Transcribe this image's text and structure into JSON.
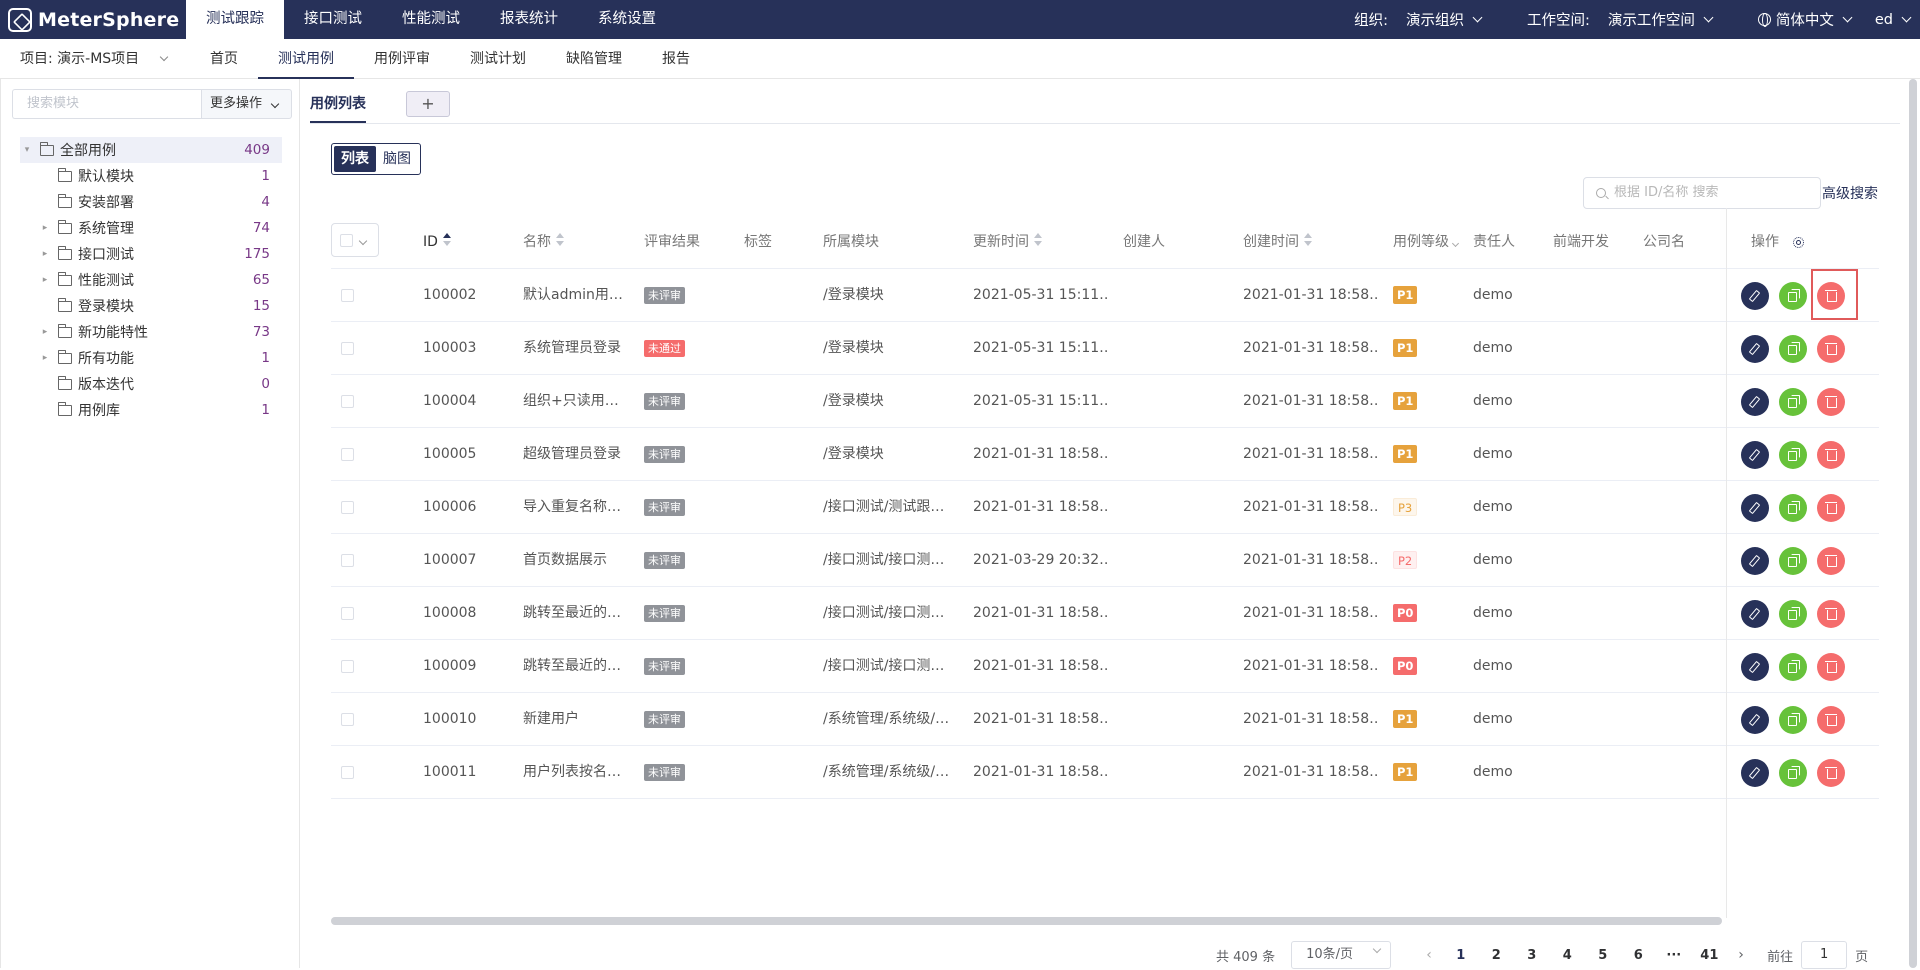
{
  "brand": "MeterSphere",
  "topnav": [
    "测试跟踪",
    "接口测试",
    "性能测试",
    "报表统计",
    "系统设置"
  ],
  "topright": {
    "org_label": "组织:",
    "org_value": "演示组织",
    "workspace_label": "工作空间:",
    "workspace_value": "演示工作空间",
    "language": "简体中文",
    "user": "ed"
  },
  "project": "项目: 演示-MS项目",
  "subnav": [
    "首页",
    "测试用例",
    "用例评审",
    "测试计划",
    "缺陷管理",
    "报告"
  ],
  "sidebar": {
    "search_placeholder": "搜索模块",
    "more_label": "更多操作",
    "tree": [
      {
        "label": "全部用例",
        "count": "409",
        "level": 0,
        "expand": "▾"
      },
      {
        "label": "默认模块",
        "count": "1",
        "level": 1,
        "expand": ""
      },
      {
        "label": "安装部署",
        "count": "4",
        "level": 1,
        "expand": ""
      },
      {
        "label": "系统管理",
        "count": "74",
        "level": 1,
        "expand": "▸"
      },
      {
        "label": "接口测试",
        "count": "175",
        "level": 1,
        "expand": "▸"
      },
      {
        "label": "性能测试",
        "count": "65",
        "level": 1,
        "expand": "▸"
      },
      {
        "label": "登录模块",
        "count": "15",
        "level": 1,
        "expand": ""
      },
      {
        "label": "新功能特性",
        "count": "73",
        "level": 1,
        "expand": "▸"
      },
      {
        "label": "所有功能",
        "count": "1",
        "level": 1,
        "expand": "▸"
      },
      {
        "label": "版本迭代",
        "count": "0",
        "level": 1,
        "expand": ""
      },
      {
        "label": "用例库",
        "count": "1",
        "level": 1,
        "expand": ""
      }
    ]
  },
  "main": {
    "tab_label": "用例列表",
    "add_tab": "+",
    "view_list": "列表",
    "view_mind": "脑图",
    "search_placeholder": "根据 ID/名称 搜索",
    "advanced_search": "高级搜索"
  },
  "table": {
    "columns": {
      "id": "ID",
      "name": "名称",
      "review": "评审结果",
      "tags": "标签",
      "module": "所属模块",
      "update_time": "更新时间",
      "creator": "创建人",
      "create_time": "创建时间",
      "priority": "用例等级",
      "maintainer": "责任人",
      "frontend": "前端开发",
      "company": "公司名",
      "ops": "操作"
    },
    "rows": [
      {
        "id": "100002",
        "name": "默认admin用…",
        "review": "未评审",
        "module": "/登录模块",
        "update": "2021-05-31 15:11…",
        "create": "2021-01-31 18:58…",
        "priority": "P1",
        "maintainer": "demo"
      },
      {
        "id": "100003",
        "name": "系统管理员登录",
        "review": "未通过",
        "module": "/登录模块",
        "update": "2021-05-31 15:11…",
        "create": "2021-01-31 18:58…",
        "priority": "P1",
        "maintainer": "demo"
      },
      {
        "id": "100004",
        "name": "组织+只读用…",
        "review": "未评审",
        "module": "/登录模块",
        "update": "2021-05-31 15:11…",
        "create": "2021-01-31 18:58…",
        "priority": "P1",
        "maintainer": "demo"
      },
      {
        "id": "100005",
        "name": "超级管理员登录",
        "review": "未评审",
        "module": "/登录模块",
        "update": "2021-01-31 18:58…",
        "create": "2021-01-31 18:58…",
        "priority": "P1",
        "maintainer": "demo"
      },
      {
        "id": "100006",
        "name": "导入重复名称…",
        "review": "未评审",
        "module": "/接口测试/测试跟…",
        "update": "2021-01-31 18:58…",
        "create": "2021-01-31 18:58…",
        "priority": "P3",
        "maintainer": "demo"
      },
      {
        "id": "100007",
        "name": "首页数据展示",
        "review": "未评审",
        "module": "/接口测试/接口测…",
        "update": "2021-03-29 20:32…",
        "create": "2021-01-31 18:58…",
        "priority": "P2",
        "maintainer": "demo"
      },
      {
        "id": "100008",
        "name": "跳转至最近的…",
        "review": "未评审",
        "module": "/接口测试/接口测…",
        "update": "2021-01-31 18:58…",
        "create": "2021-01-31 18:58…",
        "priority": "P0",
        "maintainer": "demo"
      },
      {
        "id": "100009",
        "name": "跳转至最近的…",
        "review": "未评审",
        "module": "/接口测试/接口测…",
        "update": "2021-01-31 18:58…",
        "create": "2021-01-31 18:58…",
        "priority": "P0",
        "maintainer": "demo"
      },
      {
        "id": "100010",
        "name": "新建用户",
        "review": "未评审",
        "module": "/系统管理/系统级/…",
        "update": "2021-01-31 18:58…",
        "create": "2021-01-31 18:58…",
        "priority": "P1",
        "maintainer": "demo"
      },
      {
        "id": "100011",
        "name": "用户列表按名…",
        "review": "未评审",
        "module": "/系统管理/系统级/…",
        "update": "2021-01-31 18:58…",
        "create": "2021-01-31 18:58…",
        "priority": "P1",
        "maintainer": "demo"
      }
    ]
  },
  "colors": {
    "brand": "#273159",
    "review_pending": "#909399",
    "review_failed": "#f56c6c",
    "P0": "#f56c6c",
    "P1": "#e6a23c",
    "P2_bg": "#fef0f0",
    "P2_fg": "#f56c6c",
    "P3_bg": "#fdf6ec",
    "P3_fg": "#e6a23c"
  },
  "pager": {
    "total": "共 409 条",
    "page_size": "10条/页",
    "pages": [
      "1",
      "2",
      "3",
      "4",
      "5",
      "6",
      "···",
      "41"
    ],
    "goto_prefix": "前往",
    "goto_value": "1",
    "goto_suffix": "页"
  }
}
